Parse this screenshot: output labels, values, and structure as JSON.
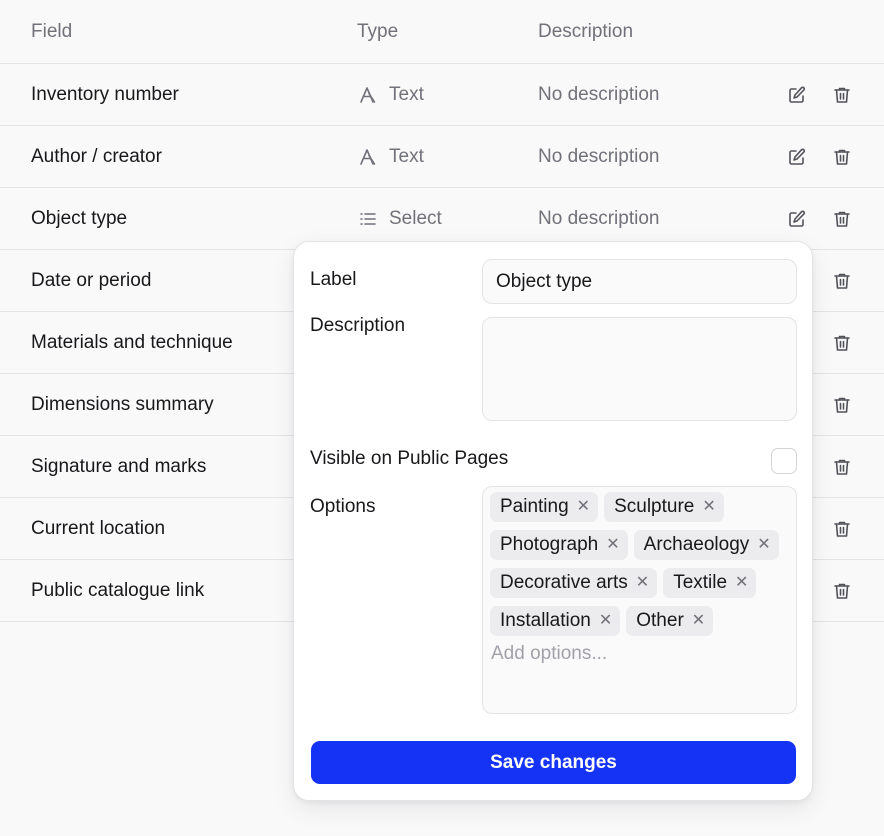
{
  "table": {
    "headers": {
      "field": "Field",
      "type": "Type",
      "description": "Description"
    },
    "rows": [
      {
        "field": "Inventory number",
        "type": "Text",
        "type_icon": "text-type-icon",
        "description": "No description"
      },
      {
        "field": "Author / creator",
        "type": "Text",
        "type_icon": "text-type-icon",
        "description": "No description"
      },
      {
        "field": "Object type",
        "type": "Select",
        "type_icon": "list-icon",
        "description": "No description"
      },
      {
        "field": "Date or period"
      },
      {
        "field": "Materials and technique"
      },
      {
        "field": "Dimensions summary"
      },
      {
        "field": "Signature and marks"
      },
      {
        "field": "Current location"
      },
      {
        "field": "Public catalogue link"
      }
    ]
  },
  "popover": {
    "label_label": "Label",
    "label_value": "Object type",
    "description_label": "Description",
    "description_value": "",
    "visible_label": "Visible on Public Pages",
    "visible_checked": false,
    "options_label": "Options",
    "options": [
      "Painting",
      "Sculpture",
      "Photograph",
      "Archaeology",
      "Decorative arts",
      "Textile",
      "Installation",
      "Other"
    ],
    "add_options_placeholder": "Add options...",
    "save_label": "Save changes"
  },
  "colors": {
    "accent": "#1533f5",
    "muted": "#71717a",
    "border": "#e4e4e7"
  }
}
